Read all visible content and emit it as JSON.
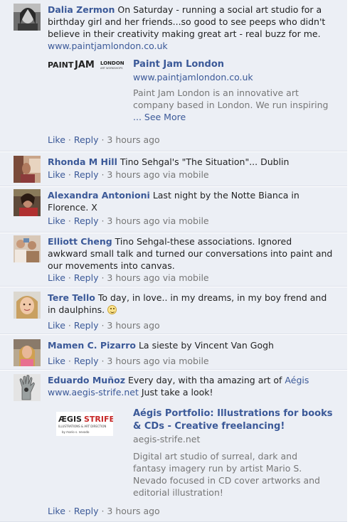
{
  "comments": [
    {
      "author": "Dalia Zermon",
      "text": "On Saturday - running a social art studio for a birthday girl and her friends...so good to see peeps who didn't believe in their creativity making great art - real buzz for me.",
      "link": "www.paintjamlondon.co.uk",
      "attachment": {
        "logo_text": "PAINT JAM LONDON",
        "logo_sub": "ART WORKSHOPS",
        "title": "Paint Jam London",
        "url": "www.paintjamlondon.co.uk",
        "desc": "Paint Jam London is an innovative art company based in London. We run inspiring",
        "see_more": "... See More"
      },
      "like": "Like",
      "reply": "Reply",
      "time": "3 hours ago",
      "via": ""
    },
    {
      "author": "Rhonda M Hill",
      "text": "Tino Sehgal's \"The Situation\"... Dublin",
      "like": "Like",
      "reply": "Reply",
      "time": "3 hours ago",
      "via": "via mobile"
    },
    {
      "author": "Alexandra Antonioni",
      "text": "Last night by the Notte Bianca in Florence. X",
      "like": "Like",
      "reply": "Reply",
      "time": "3 hours ago",
      "via": "via mobile"
    },
    {
      "author": "Elliott Cheng",
      "text": "Tino Sehgal-these associations. Ignored awkward small talk and turned our conversations into paint and our movements into canvas.",
      "like": "Like",
      "reply": "Reply",
      "time": "3 hours ago",
      "via": "via mobile"
    },
    {
      "author": "Tere Tello",
      "text": "To day, in love.. in my dreams, in my boy frend and in daulphins.",
      "emoji": "smiley-icon",
      "like": "Like",
      "reply": "Reply",
      "time": "3 hours ago",
      "via": ""
    },
    {
      "author": "Mamen C. Pizarro",
      "text": "La sieste by Vincent Van Gogh",
      "like": "Like",
      "reply": "Reply",
      "time": "3 hours ago",
      "via": "via mobile"
    },
    {
      "author": "Eduardo Muñoz",
      "text": "Every day, with tha amazing art of",
      "mention": "Aégis",
      "link": "www.aegis-strife.net",
      "text_after": "Just take a look!",
      "attachment": {
        "logo_text": "AÉGIS STRIFE",
        "logo_sub": "ILLUSTRATIONS & ART DIRECTION",
        "logo_sub2": "by mario s. nevado",
        "title": "Aégis Portfolio: Illustrations for books & CDs - Creative freelancing!",
        "url": "aegis-strife.net",
        "desc": "Digital art studio of surreal, dark and fantasy imagery run by artist Mario S. Nevado focused in CD cover artworks and editorial illustration!"
      },
      "like": "Like",
      "reply": "Reply",
      "time": "3 hours ago",
      "via": ""
    }
  ],
  "colors": {
    "link": "#3b5998",
    "background": "#eceff5",
    "meta": "#777777"
  }
}
